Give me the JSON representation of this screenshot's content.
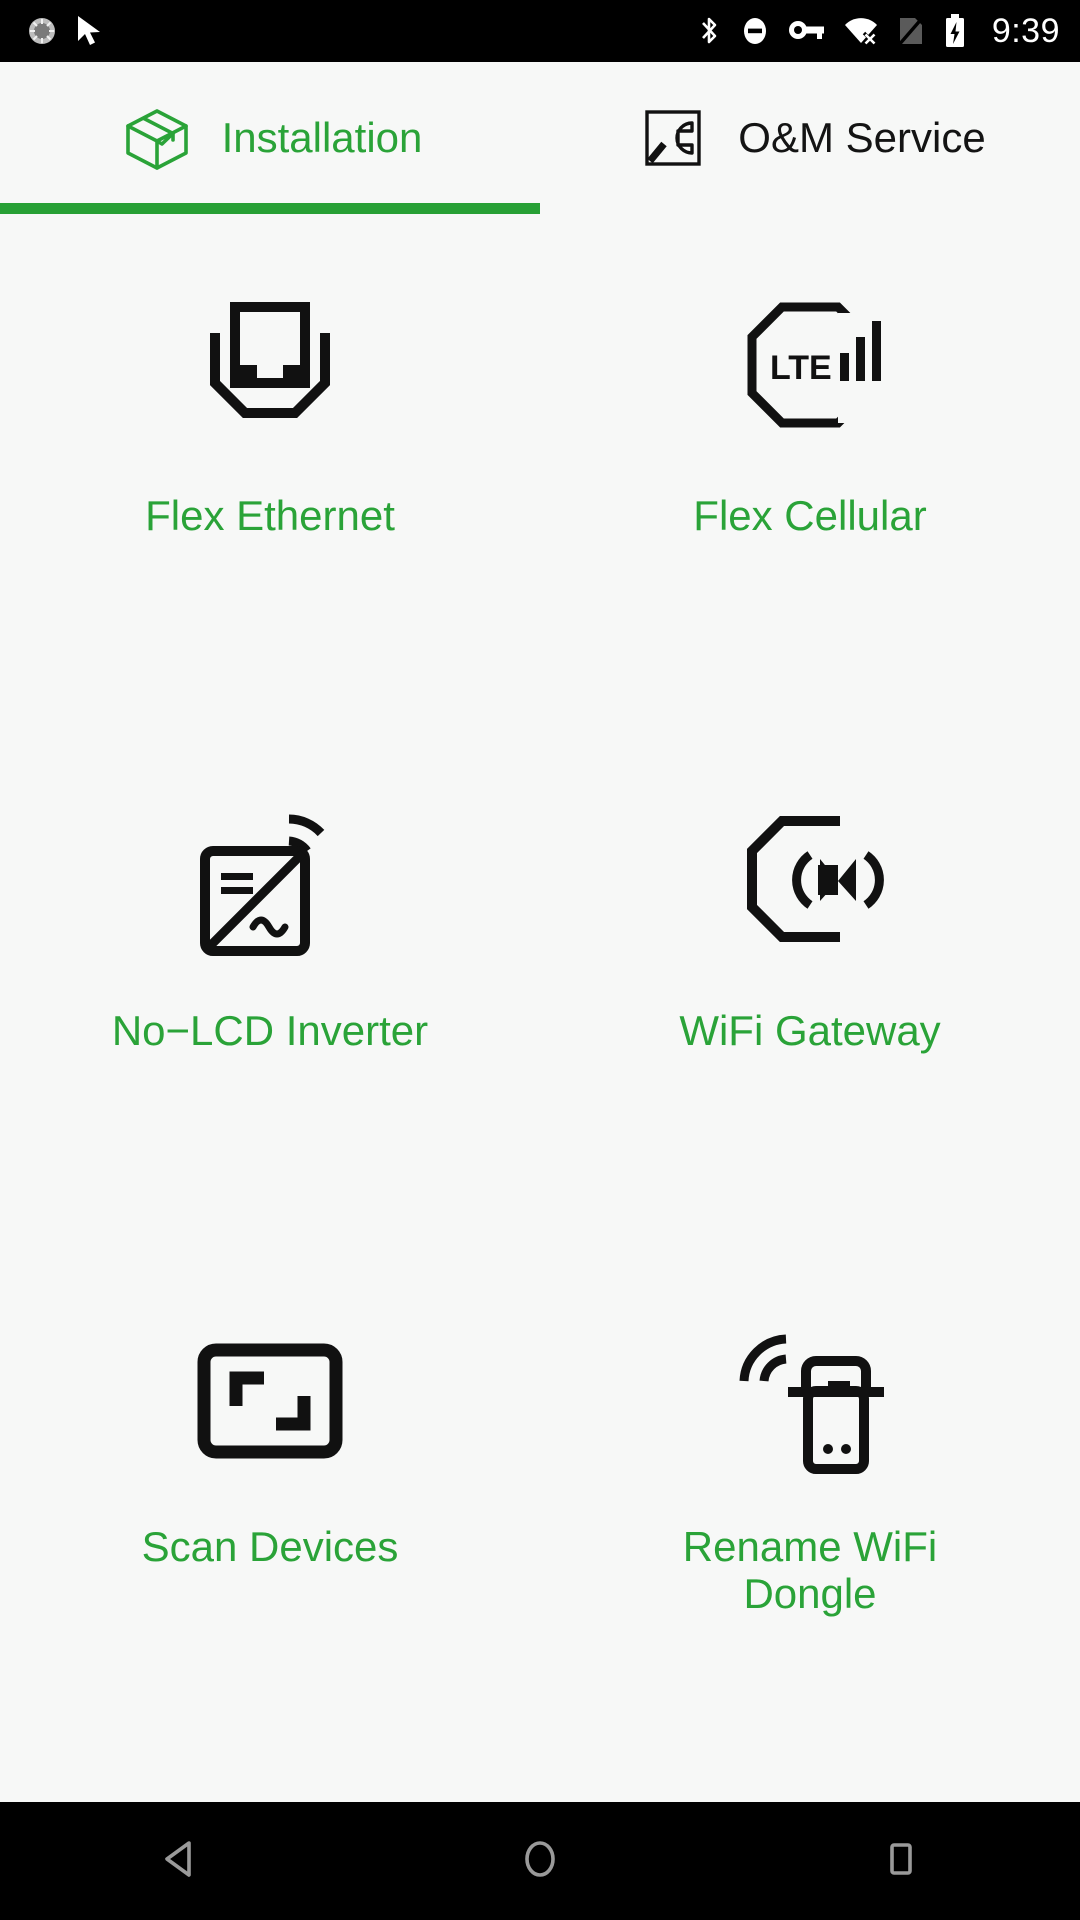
{
  "status_bar": {
    "time": "9:39",
    "left_icons": [
      "sync-spinner-icon",
      "cursor-arrow-icon"
    ],
    "right_icons": [
      "bluetooth-icon",
      "do-not-disturb-icon",
      "vpn-key-icon",
      "wifi-no-internet-icon",
      "no-sim-icon",
      "battery-charging-icon"
    ],
    "background": "#000000",
    "foreground": "#ffffff"
  },
  "tabs": {
    "accent_color": "#27a035",
    "items": [
      {
        "id": "installation",
        "label": "Installation",
        "icon": "open-box-icon",
        "active": true
      },
      {
        "id": "om-service",
        "label": "O&M Service",
        "icon": "wrench-in-square-icon",
        "active": false
      }
    ]
  },
  "grid": {
    "label_color": "#2aa338",
    "icon_color": "#111111",
    "items": [
      {
        "id": "flex-ethernet",
        "label": "Flex Ethernet",
        "icon": "ethernet-port-icon"
      },
      {
        "id": "flex-cellular",
        "label": "Flex Cellular",
        "icon": "lte-octagon-signal-icon"
      },
      {
        "id": "no-lcd-inverter",
        "label": "No−LCD Inverter",
        "icon": "inverter-wireless-icon"
      },
      {
        "id": "wifi-gateway",
        "label": "WiFi Gateway",
        "icon": "octagon-broadcast-icon"
      },
      {
        "id": "scan-devices",
        "label": "Scan Devices",
        "icon": "scan-frame-icon"
      },
      {
        "id": "rename-wifi-dongle",
        "label": "Rename WiFi Dongle",
        "icon": "wifi-dongle-icon"
      }
    ]
  },
  "nav_bar": {
    "background": "#000000",
    "items": [
      {
        "id": "back",
        "icon": "back-triangle-icon"
      },
      {
        "id": "home",
        "icon": "home-circle-icon"
      },
      {
        "id": "recents",
        "icon": "recents-square-icon"
      }
    ]
  }
}
